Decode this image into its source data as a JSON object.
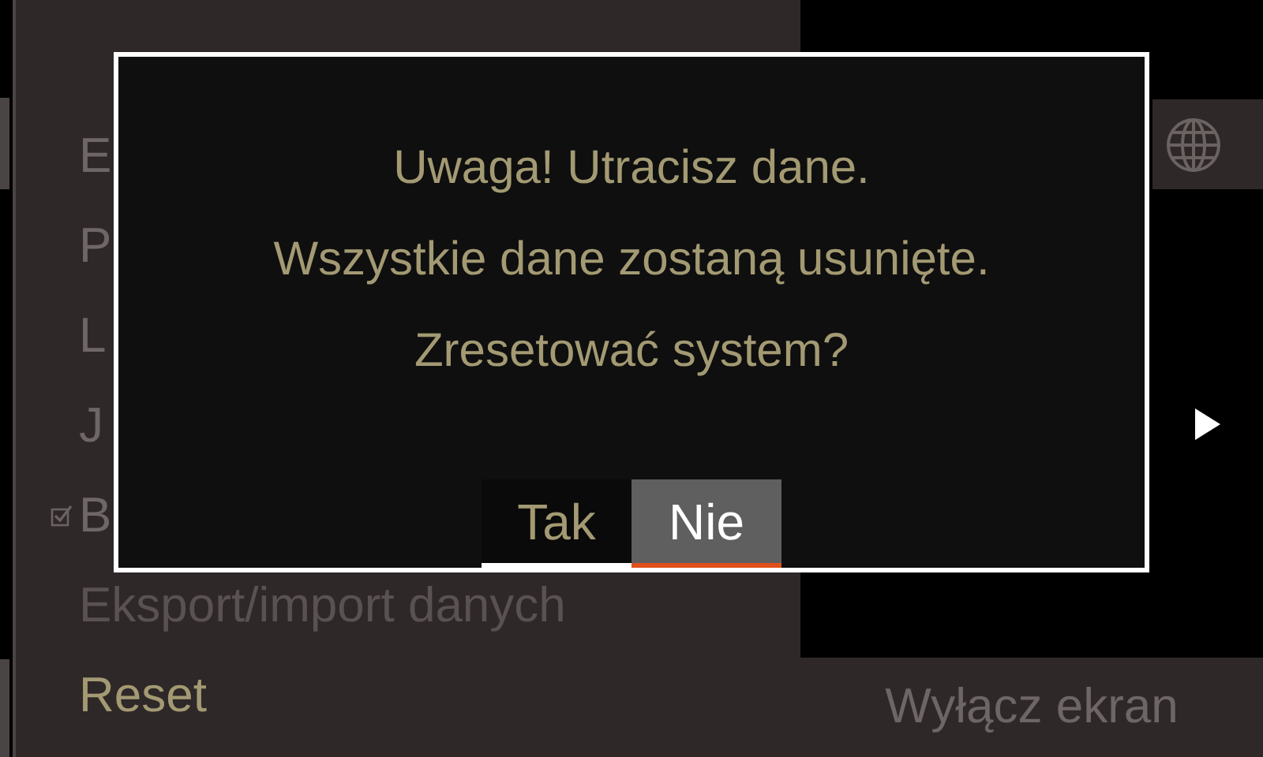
{
  "menu": {
    "items": [
      {
        "label": "E",
        "kind": "plain",
        "selected": false,
        "disabled": false
      },
      {
        "label": "P",
        "kind": "plain",
        "selected": false,
        "disabled": false
      },
      {
        "label": "L",
        "kind": "plain",
        "selected": false,
        "disabled": false
      },
      {
        "label": "J",
        "kind": "plain",
        "selected": false,
        "disabled": false
      },
      {
        "label": "B",
        "kind": "checkbox",
        "checked": true,
        "selected": false,
        "disabled": false
      },
      {
        "label": "Eksport/import danych",
        "kind": "plain",
        "selected": false,
        "disabled": true
      },
      {
        "label": "Reset",
        "kind": "plain",
        "selected": true,
        "disabled": false
      }
    ]
  },
  "screen_off_button": {
    "label": "Wyłącz ekran"
  },
  "dialog": {
    "lines": [
      "Uwaga! Utracisz dane.",
      "Wszystkie dane zostaną usunięte.",
      "Zresetować system?"
    ],
    "buttons": [
      {
        "label": "Tak",
        "selected": false
      },
      {
        "label": "Nie",
        "selected": true
      }
    ]
  }
}
